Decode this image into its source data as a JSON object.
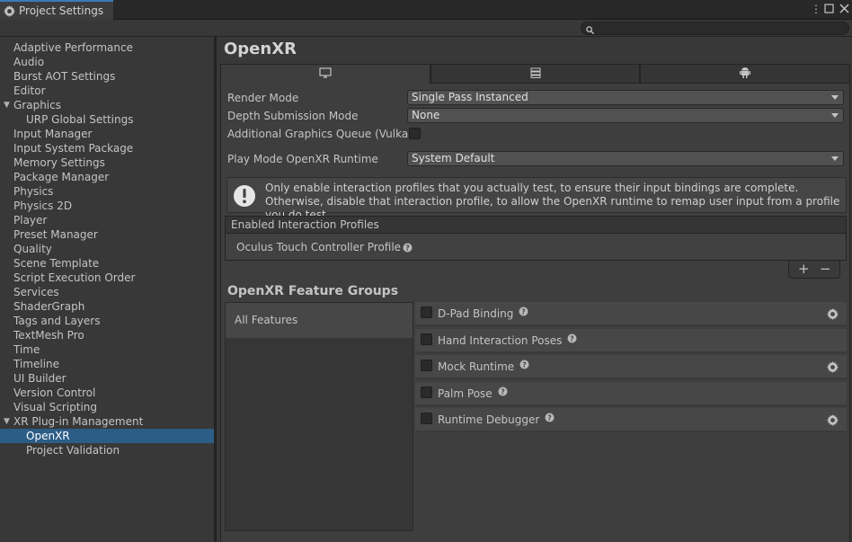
{
  "window": {
    "tab_title": "Project Settings",
    "menu_icon": "kebab-icon",
    "close_icon": "close-icon"
  },
  "search": {
    "placeholder": ""
  },
  "sidebar": {
    "items": [
      {
        "label": "Adaptive Performance",
        "indent": 0
      },
      {
        "label": "Audio",
        "indent": 0
      },
      {
        "label": "Burst AOT Settings",
        "indent": 0
      },
      {
        "label": "Editor",
        "indent": 0
      },
      {
        "label": "Graphics",
        "indent": 0,
        "expanded": true
      },
      {
        "label": "URP Global Settings",
        "indent": 1
      },
      {
        "label": "Input Manager",
        "indent": 0
      },
      {
        "label": "Input System Package",
        "indent": 0
      },
      {
        "label": "Memory Settings",
        "indent": 0
      },
      {
        "label": "Package Manager",
        "indent": 0
      },
      {
        "label": "Physics",
        "indent": 0
      },
      {
        "label": "Physics 2D",
        "indent": 0
      },
      {
        "label": "Player",
        "indent": 0
      },
      {
        "label": "Preset Manager",
        "indent": 0
      },
      {
        "label": "Quality",
        "indent": 0
      },
      {
        "label": "Scene Template",
        "indent": 0
      },
      {
        "label": "Script Execution Order",
        "indent": 0
      },
      {
        "label": "Services",
        "indent": 0
      },
      {
        "label": "ShaderGraph",
        "indent": 0
      },
      {
        "label": "Tags and Layers",
        "indent": 0
      },
      {
        "label": "TextMesh Pro",
        "indent": 0
      },
      {
        "label": "Time",
        "indent": 0
      },
      {
        "label": "Timeline",
        "indent": 0
      },
      {
        "label": "UI Builder",
        "indent": 0
      },
      {
        "label": "Version Control",
        "indent": 0
      },
      {
        "label": "Visual Scripting",
        "indent": 0
      },
      {
        "label": "XR Plug-in Management",
        "indent": 0,
        "expanded": true
      },
      {
        "label": "OpenXR",
        "indent": 1,
        "selected": true
      },
      {
        "label": "Project Validation",
        "indent": 1
      }
    ]
  },
  "main": {
    "title": "OpenXR",
    "platform_tabs": [
      "desktop-icon",
      "server-icon",
      "android-icon"
    ],
    "render_mode": {
      "label": "Render Mode",
      "value": "Single Pass Instanced"
    },
    "depth_mode": {
      "label": "Depth Submission Mode",
      "value": "None"
    },
    "graphics_queue": {
      "label": "Additional Graphics Queue (Vulkan)",
      "checked": false
    },
    "runtime": {
      "label": "Play Mode OpenXR Runtime",
      "value": "System Default"
    },
    "help_text": "Only enable interaction profiles that you actually test, to ensure their input bindings are complete. Otherwise, disable that interaction profile, to allow the OpenXR runtime to remap user input from a profile you do test.",
    "profiles": {
      "header": "Enabled Interaction Profiles",
      "items": [
        "Oculus Touch Controller Profile"
      ],
      "add": "+",
      "remove": "−"
    },
    "feature_groups": {
      "title": "OpenXR Feature Groups",
      "groups": [
        "All Features"
      ],
      "features": [
        {
          "label": "D-Pad Binding",
          "checked": false,
          "has_settings": true
        },
        {
          "label": "Hand Interaction Poses",
          "checked": false,
          "has_settings": false
        },
        {
          "label": "Mock Runtime",
          "checked": false,
          "has_settings": true
        },
        {
          "label": "Palm Pose",
          "checked": false,
          "has_settings": false
        },
        {
          "label": "Runtime Debugger",
          "checked": false,
          "has_settings": true
        }
      ]
    }
  },
  "colors": {
    "accent": "#3a79bb",
    "selection": "#2c5d87",
    "background": "#383838"
  }
}
